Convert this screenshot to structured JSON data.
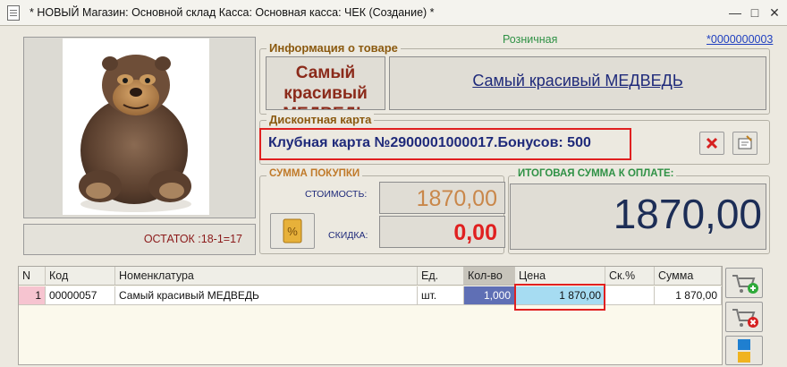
{
  "window": {
    "title": "* НОВЫЙ Магазин: Основной склад Касса: Основная касса: ЧЕК (Создание) *"
  },
  "header": {
    "price_type": "Розничная",
    "doc_number": "*0000000003"
  },
  "product_image": {
    "alt": "teddy-bear-photo"
  },
  "stock": {
    "text": "ОСТАТОК :18-1=17"
  },
  "product_info": {
    "group_title": "Информация о товаре",
    "short_name": "Самый красивый МЕДВЕДЬ",
    "full_name": "Самый красивый МЕДВЕДЬ"
  },
  "discount_card": {
    "group_title": "Дисконтная карта",
    "text": "Клубная карта №2900001000017.Бонусов: 500"
  },
  "purchase": {
    "group_title": "СУММА ПОКУПКИ",
    "cost_label": "СТОИМОСТЬ:",
    "cost_value": "1870,00",
    "discount_label": "СКИДКА:",
    "discount_value": "0,00"
  },
  "total": {
    "group_title": "ИТОГОВАЯ СУММА К ОПЛАТЕ:",
    "value": "1870,00"
  },
  "table": {
    "columns": [
      "N",
      "Код",
      "Номенклатура",
      "Ед.",
      "Кол-во",
      "Цена",
      "Ск.%",
      "Сумма"
    ],
    "rows": [
      {
        "n": "1",
        "code": "00000057",
        "name": "Самый красивый МЕДВЕДЬ",
        "unit": "шт.",
        "qty": "1,000",
        "price": "1 870,00",
        "disc": "",
        "sum": "1 870,00"
      }
    ]
  },
  "colors": {
    "accent_red": "#e02020",
    "title_blue": "#1f2a7a",
    "cost_orange": "#c9874a",
    "total_green": "#2f9145"
  },
  "icons": [
    "document-icon",
    "minimize-icon",
    "maximize-icon",
    "close-icon",
    "delete-card-icon",
    "edit-card-icon",
    "discount-icon",
    "cart-add-icon",
    "cart-remove-icon",
    "blocks-icon"
  ]
}
